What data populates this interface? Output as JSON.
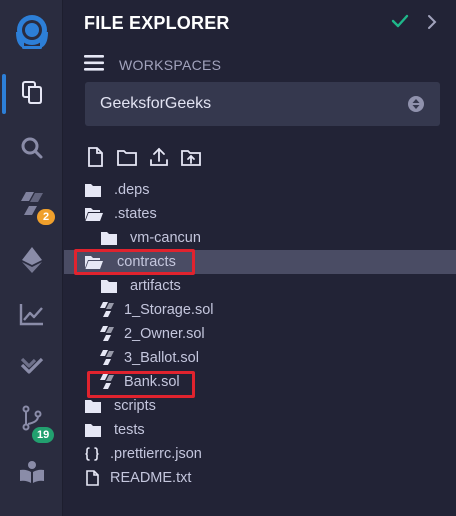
{
  "rail": {
    "items": [
      {
        "icon": "remix-logo-icon",
        "active": false
      },
      {
        "icon": "file-explorer-icon",
        "active": true
      },
      {
        "icon": "search-icon",
        "active": false
      },
      {
        "icon": "solidity-compiler-icon",
        "badge": "2",
        "badge_color": "#f0a02c"
      },
      {
        "icon": "deploy-run-icon"
      },
      {
        "icon": "analytics-icon"
      },
      {
        "icon": "test-check-icon"
      },
      {
        "icon": "git-branch-icon",
        "badge": "19",
        "badge_color": "#22a06f"
      },
      {
        "icon": "learn-book-icon"
      }
    ]
  },
  "panel": {
    "title": "FILE EXPLORER",
    "workspaces_label": "WORKSPACES",
    "workspace": "GeeksforGeeks"
  },
  "toolbar": {
    "icons": [
      "new-file-icon",
      "new-folder-icon",
      "upload-file-icon",
      "upload-folder-icon"
    ]
  },
  "tree": [
    {
      "name": ".deps",
      "type": "folder",
      "expanded": false,
      "depth": 0
    },
    {
      "name": ".states",
      "type": "folder",
      "expanded": true,
      "depth": 0
    },
    {
      "name": "vm-cancun",
      "type": "folder",
      "expanded": false,
      "depth": 1
    },
    {
      "name": "contracts",
      "type": "folder",
      "expanded": true,
      "depth": 0,
      "selected": true,
      "highlighted": true
    },
    {
      "name": "artifacts",
      "type": "folder",
      "expanded": false,
      "depth": 1
    },
    {
      "name": "1_Storage.sol",
      "type": "solidity",
      "depth": 1
    },
    {
      "name": "2_Owner.sol",
      "type": "solidity",
      "depth": 1
    },
    {
      "name": "3_Ballot.sol",
      "type": "solidity",
      "depth": 1
    },
    {
      "name": "Bank.sol",
      "type": "solidity",
      "depth": 1,
      "highlighted": true
    },
    {
      "name": "scripts",
      "type": "folder",
      "expanded": false,
      "depth": 0
    },
    {
      "name": "tests",
      "type": "folder",
      "expanded": false,
      "depth": 0
    },
    {
      "name": ".prettierrc.json",
      "type": "json",
      "depth": 0
    },
    {
      "name": "README.txt",
      "type": "file",
      "depth": 0
    }
  ],
  "colors": {
    "highlight_box": "#e0232e",
    "selected_row": "#4a4c64",
    "accent": "#2d7fd7",
    "check": "#1fb78a"
  }
}
